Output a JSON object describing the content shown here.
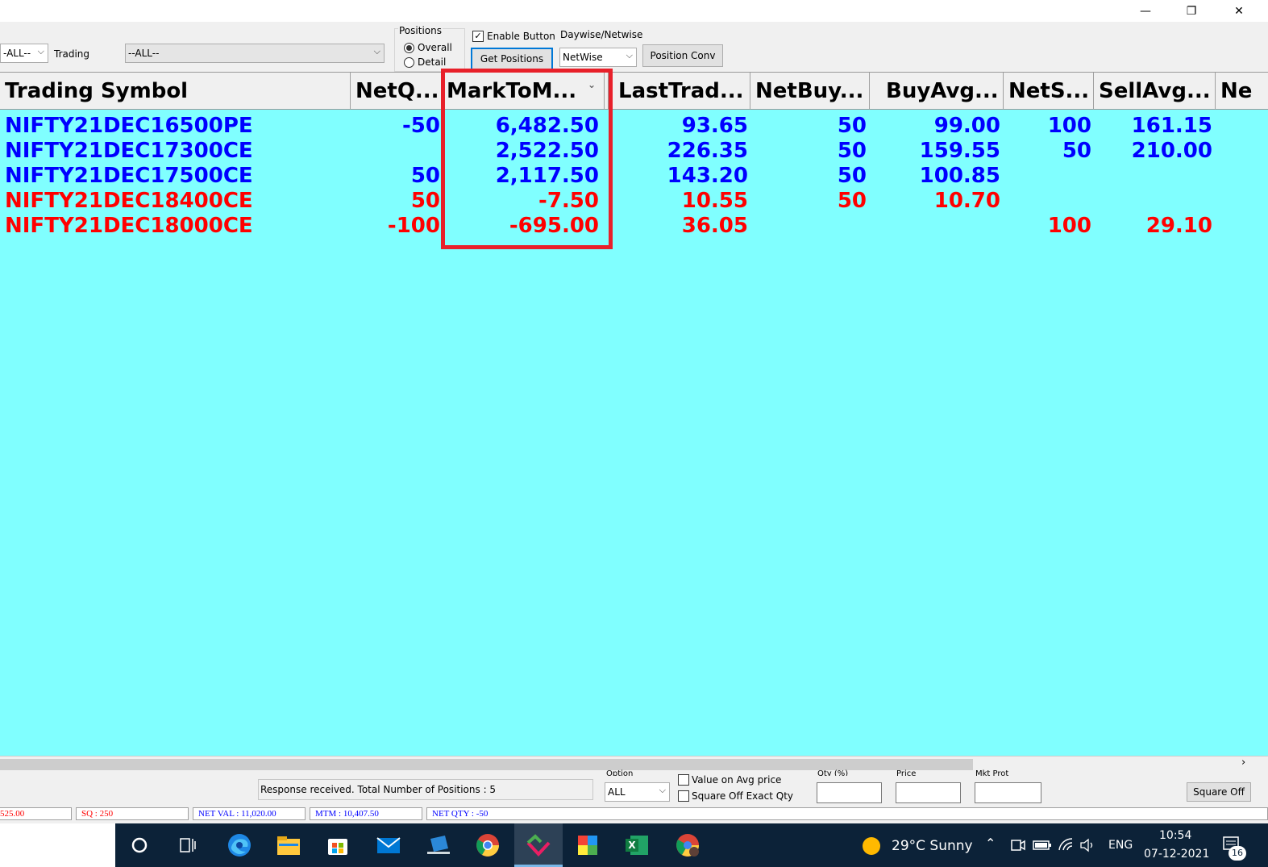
{
  "window": {
    "minimize": "—",
    "restore": "❐",
    "close": "✕"
  },
  "toolbar": {
    "filter1_value": "-ALL--",
    "trading_label": "Trading",
    "trading_value": "--ALL--",
    "positions_group": "Positions",
    "overall_label": "Overall",
    "detail_label": "Detail",
    "enable_button_label": "Enable Button",
    "get_positions_label": "Get Positions",
    "daywise_label": "Daywise/Netwise",
    "netwise_value": "NetWise",
    "position_conv_label": "Position Conv"
  },
  "grid": {
    "columns": [
      "Trading Symbol",
      "NetQ...",
      "MarkToM...",
      "LastTrad...",
      "NetBuy...",
      "BuyAvg...",
      "NetS...",
      "SellAvg...",
      "Ne"
    ],
    "rows": [
      {
        "color": "blue",
        "cells": [
          "NIFTY21DEC16500PE",
          "-50",
          "6,482.50",
          "93.65",
          "50",
          "99.00",
          "100",
          "161.15",
          ""
        ]
      },
      {
        "color": "blue",
        "cells": [
          "NIFTY21DEC17300CE",
          "",
          "2,522.50",
          "226.35",
          "50",
          "159.55",
          "50",
          "210.00",
          ""
        ]
      },
      {
        "color": "blue",
        "cells": [
          "NIFTY21DEC17500CE",
          "50",
          "2,117.50",
          "143.20",
          "50",
          "100.85",
          "",
          "",
          ""
        ]
      },
      {
        "color": "red",
        "cells": [
          "NIFTY21DEC18400CE",
          "50",
          "-7.50",
          "10.55",
          "50",
          "10.70",
          "",
          "",
          ""
        ]
      },
      {
        "color": "red",
        "cells": [
          "NIFTY21DEC18000CE",
          "-100",
          "-695.00",
          "36.05",
          "",
          "",
          "100",
          "29.10",
          ""
        ]
      }
    ]
  },
  "bottom": {
    "response_text": "Response received.  Total Number of Positions : 5",
    "option_label": "Option",
    "option_value": "ALL",
    "value_on_avg_label": "Value on Avg  price",
    "square_off_exact_label": "Square Off Exact Qty",
    "qty_label": "Qty (%)",
    "price_label": "Price",
    "mkt_prot_label": "Mkt Prot",
    "square_off_label": "Square Off"
  },
  "status": {
    "s1": "525.00",
    "sq": "SQ : 250",
    "net_val": "NET VAL : 11,020.00",
    "mtm": "MTM : 10,407.50",
    "net_qty": "NET QTY : -50"
  },
  "taskbar": {
    "weather": "29°C  Sunny",
    "lang": "ENG",
    "time": "10:54",
    "date": "07-12-2021",
    "notif_count": "16"
  }
}
